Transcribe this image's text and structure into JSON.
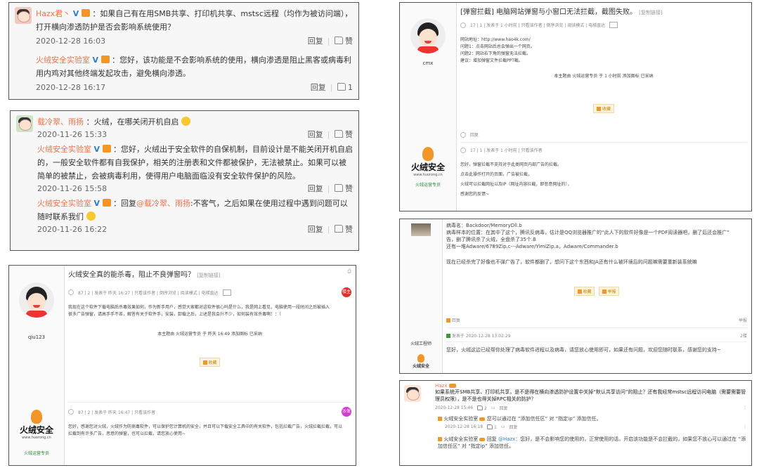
{
  "weibo1": {
    "author": "Hazx君丶",
    "text": "：如果自己有在用SMB共享、打印机共享、mstsc远程（均作为被访问端），打开横向渗透防护是否会影响系统使用？",
    "time": "2020-12-28 16:03",
    "reply_label": "回复",
    "like_label": "赞",
    "reply": {
      "author": "火绒安全实验室",
      "text": "：您好，该功能是不会影响系统的使用，横向渗透是阻止黑客或病毒利用内鸡对其他终端发起攻击，避免横向渗透。",
      "time": "2020-12-28 16:17",
      "like_count": "1"
    }
  },
  "weibo2": {
    "author": "载冷翠、雨扬",
    "text": "：火绒，在哪关闭开机自启",
    "time": "2020-11-26 15:33",
    "reply_label": "回复",
    "like_label": "赞",
    "reply1": {
      "author": "火绒安全实验室",
      "text": "：您好，火绒出于安全软件的自保机制，目前设计是不能关闭开机自启的，一般安全软件都有自我保护，相关的注册表和文件都被保护，无法被禁止。如果可以被简单的被禁止，会被病毒利用，使得用户电脑面临没有安全软件保护的风险。",
      "time": "2020-11-26 15:58"
    },
    "reply2": {
      "author": "火绒安全实验室",
      "text_prefix": "：回复",
      "mention": "@载冷翠、雨扬",
      "text": ":不客气，之后如果在使用过程中遇到问题可以随时联系我们",
      "time": "2020-11-26 16:22"
    }
  },
  "forum1": {
    "title": "火绒安全真的能杀毒，阻止不良弹窗吗？",
    "title_suffix": "[复制链接]",
    "post_meta": "87 | 2 | 发表于 昨天 16:27 | 只看该作者 | 倒序浏览 | 阅读模式 | 电梯直达",
    "user": "qiu123",
    "body": "我现在这个软件下载电脑后杀毒效果如何，作为新手用户，感觉大家都对这软件很心吗是什么，我是网上看见，电脑使用一段时间之后被插入很多广告弹窗，请高手手不吝，解答有关于软件手，安装，卸载之后，上述是我会升不少，如何装有效杀毒啊！：（",
    "edit_note": "本主题由 火绒运营专员 于 昨天 16:49 添加图标 已采纳",
    "collect": "收藏",
    "floor_badge": "楼主",
    "reply_meta": "87 | 2 | 发表于 昨天 16:47 | 只看该作者",
    "reply_body": "您好，感谢您对火绒，火绒作为防病毒软件，可以保护您计算机的安全，并且可以下载安全工具中的有关软件，包括拦截广告，火绒拦截拦截，可以拦截到有许多广告，恶意的弹窗，也可以拦截，请您放心使用~",
    "floor2_badge": "沙发",
    "staff_tag": "火绒运营专员",
    "logo_cn": "火绒安全",
    "logo_en": "www.huorong.cn"
  },
  "forum2": {
    "title": "[弹窗拦截] 电脑网站弹窗与小窗口无法拦截，截图失败。",
    "title_suffix": "[复制链接]",
    "post_meta": "17 | 1 | 发表于 1 小时前 | 只看该作者 | 倒序浏览 | 阅读模式 | 电梯直达",
    "user": "cmx",
    "body_lines": [
      "网站地址：http://www.hao4k.com/",
      "问题1：点击网站后总会弹出一个网页。",
      "问题2：网站右下角的弹窗无法拦截。",
      "建议：增加弹窗文件拦截PPT截。"
    ],
    "edit_note": "本主题由 火绒运营专员 于 1 小时前 添加图标 已采纳",
    "collect": "收藏",
    "reply_label": "回复",
    "reply_meta": "17 | 1 | 发表于 1 小时前 | 只看该作者",
    "reply_lines": [
      "您好，弹窗拦截不支持对于此类网页内部广告的拦截。",
      "点击此操作打开的页面，广告被拦截，",
      "火绒可以拦截网址以及IP（网址内容拦截，即恶意网址的），",
      "感谢您的反馈~"
    ],
    "staff_tag": "火绒运营专员",
    "logo_cn": "火绒安全",
    "logo_en": "www.huorong.cn"
  },
  "forum3": {
    "body_lines": [
      "病毒名：Backdoor/MemoryDll.b",
      "病毒样本的位置：在其中了这个，腾讯反病毒，估计是QQ浏览器推广的“此人下的软件好像是一个PDF阅读器吧，删了后还会推广”",
      "告，删了腾讯杀了火绒，全盘杀了35个.B",
      "还有一堆Adware/6789Zip.c---Adware/YimiZip.a，Adware/Commander.b"
    ],
    "question": "现在已经杀完了好像也不弹广告了，软件都删了，想问下这个东西和JA还有什么被环境后的问题嘛需要重新装系统嘛",
    "collect": "收藏",
    "report": "举报",
    "reply_label": "回复",
    "report2": "举报",
    "staff_label": "火绒工程师",
    "reply_time": "发表于 2020-12-28 13:02:29",
    "floor": "2楼",
    "reply_body": "您好，火绒这边已经帮你处理了病毒软件进程以及病毒，请您放心使用即可，如果还有问题，欢迎您随时联系，感谢您的支持~",
    "logo_cn": "火绒安全"
  },
  "forum4": {
    "author": "Hazx",
    "question": "如果系统开SMB共享、打印机共享，是不是得在横向渗透防护设置中关掉“默认共享访问”的阻止？还有我经常mstsc远程访问电脑（需要需要管理员权限），是不是也得关掉RPC相关的防护？",
    "time": "2020-12-28 15:46",
    "likes": "2",
    "reply_label": "回复",
    "reply1_author": "火绒安全实验室",
    "reply1_text": "您可以通过在 “添加信任区” 对 “指定ip” 添加信任。",
    "reply1_time": "2020-12-28 16:18",
    "reply1_likes": "1",
    "reply2_author": "火绒安全实验室",
    "reply2_prefix": "回复",
    "reply2_mention": "@Hazx",
    "reply2_text": "：您好，是不会影响您的使用的，正常使用的话，开启该功能是不会拦截的，如果您不放心可以通过在 “添加信任区” 对 “指定ip” 添加信任。"
  }
}
